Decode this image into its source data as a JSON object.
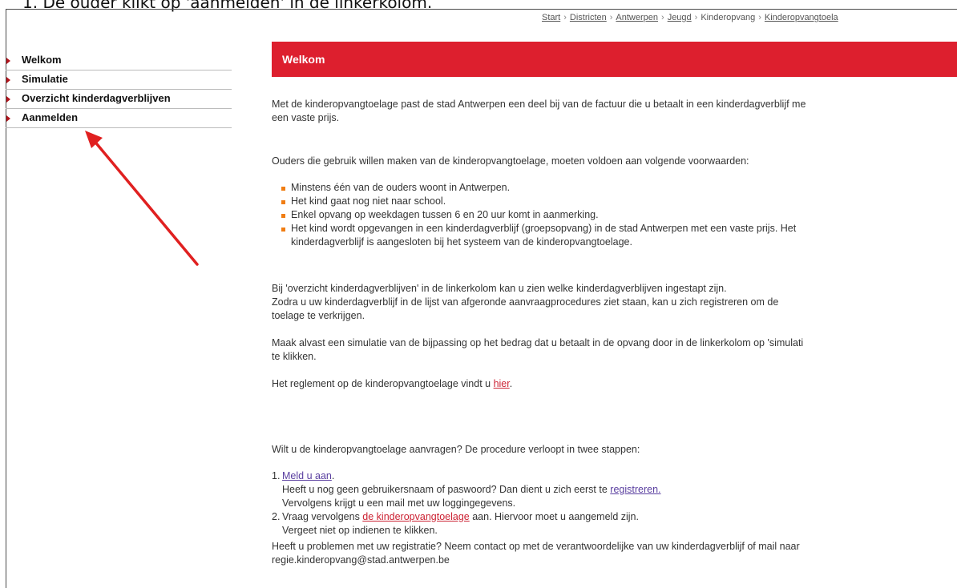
{
  "caption": "1.  De ouder klikt op 'aanmelden' in de linkerkolom.",
  "breadcrumb": [
    {
      "label": "Start",
      "link": true
    },
    {
      "label": "Districten",
      "link": true
    },
    {
      "label": "Antwerpen",
      "link": true
    },
    {
      "label": "Jeugd",
      "link": true
    },
    {
      "label": "Kinderopvang",
      "link": false
    },
    {
      "label": "Kinderopvangtoela",
      "link": true
    }
  ],
  "breadcrumb_sep": "›",
  "sidebar": {
    "items": [
      {
        "label": "Welkom"
      },
      {
        "label": "Simulatie"
      },
      {
        "label": "Overzicht kinderdagverblijven"
      },
      {
        "label": "Aanmelden"
      }
    ]
  },
  "banner": {
    "title": "Welkom"
  },
  "content": {
    "intro_l1": "Met de kinderopvangtoelage past de stad Antwerpen een deel bij van de factuur die u betaalt in een kinderdagverblijf me",
    "intro_l2": "een vaste prijs.",
    "conditions_intro": "Ouders die gebruik willen maken van de kinderopvangtoelage, moeten voldoen aan volgende voorwaarden:",
    "conditions": [
      "Minstens één van de ouders woont in Antwerpen.",
      "Het kind gaat nog niet naar school.",
      "Enkel opvang op weekdagen tussen 6 en 20 uur komt in aanmerking.",
      "Het kind wordt opgevangen in een kinderdagverblijf (groepsopvang) in de stad Antwerpen met een vaste prijs. Het",
      "kinderdagverblijf is aangesloten bij het systeem van de kinderopvangtoelage."
    ],
    "overview_l1": "Bij 'overzicht kinderdagverblijven' in de linkerkolom kan u zien welke kinderdagverblijven ingestapt zijn.",
    "overview_l2": "Zodra u uw kinderdagverblijf in de lijst van afgeronde aanvraagprocedures ziet staan, kan u zich registreren om de",
    "overview_l3": "toelage te verkrijgen.",
    "simulation_l1": "Maak alvast een simulatie van de bijpassing op het bedrag dat u betaalt in de opvang door in de linkerkolom op 'simulati",
    "simulation_l2": "te klikken.",
    "reglement_text": "Het reglement op de kinderopvangtoelage vindt u ",
    "reglement_link": "hier",
    "reglement_end": ".",
    "procedure_intro": "Wilt u de kinderopvangtoelage aanvragen? De procedure verloopt in twee stappen:",
    "step1_num": "1.",
    "step1_link": "Meld u aan",
    "step1_end": ".",
    "step1_l2_text": "Heeft u nog geen gebruikersnaam of paswoord? Dan dient u zich eerst te ",
    "step1_l2_link": "registreren.",
    "step1_l3": "Vervolgens krijgt u een mail met uw loggingegevens.",
    "step2_num": "2.",
    "step2_text_a": "Vraag vervolgens ",
    "step2_link": "de kinderopvangtoelage",
    "step2_text_b": " aan. Hiervoor moet u aangemeld zijn.",
    "step2_l2": "Vergeet niet op indienen te klikken.",
    "problems_l1": "Heeft u problemen met uw registratie? Neem contact op met de verantwoordelijke van uw kinderdagverblijf of mail naar",
    "problems_l2": "regie.kinderopvang@stad.antwerpen.be"
  },
  "colors": {
    "banner": "#dd1f2e",
    "arrow": "#e02020",
    "bullet": "#f07d12",
    "sidebar_marker": "#b4141c"
  },
  "annotation": {
    "icon": "red-arrow-icon"
  }
}
